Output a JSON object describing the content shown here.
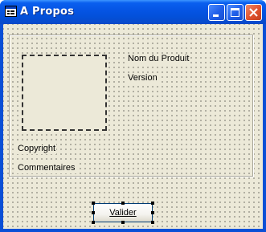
{
  "window": {
    "title": "A Propos",
    "icon": "form-app-icon",
    "controls": {
      "minimize": "minimize-icon",
      "maximize": "maximize-icon",
      "close": "close-icon"
    }
  },
  "form": {
    "product_name_label": "Nom du Produit",
    "version_label": "Version",
    "copyright_label": "Copyright",
    "comments_label": "Commentaires",
    "ok_button_label": "Valider"
  },
  "colors": {
    "title_bar": "#0554e3",
    "client_bg": "#ece9d8",
    "close_button": "#e0512c"
  }
}
